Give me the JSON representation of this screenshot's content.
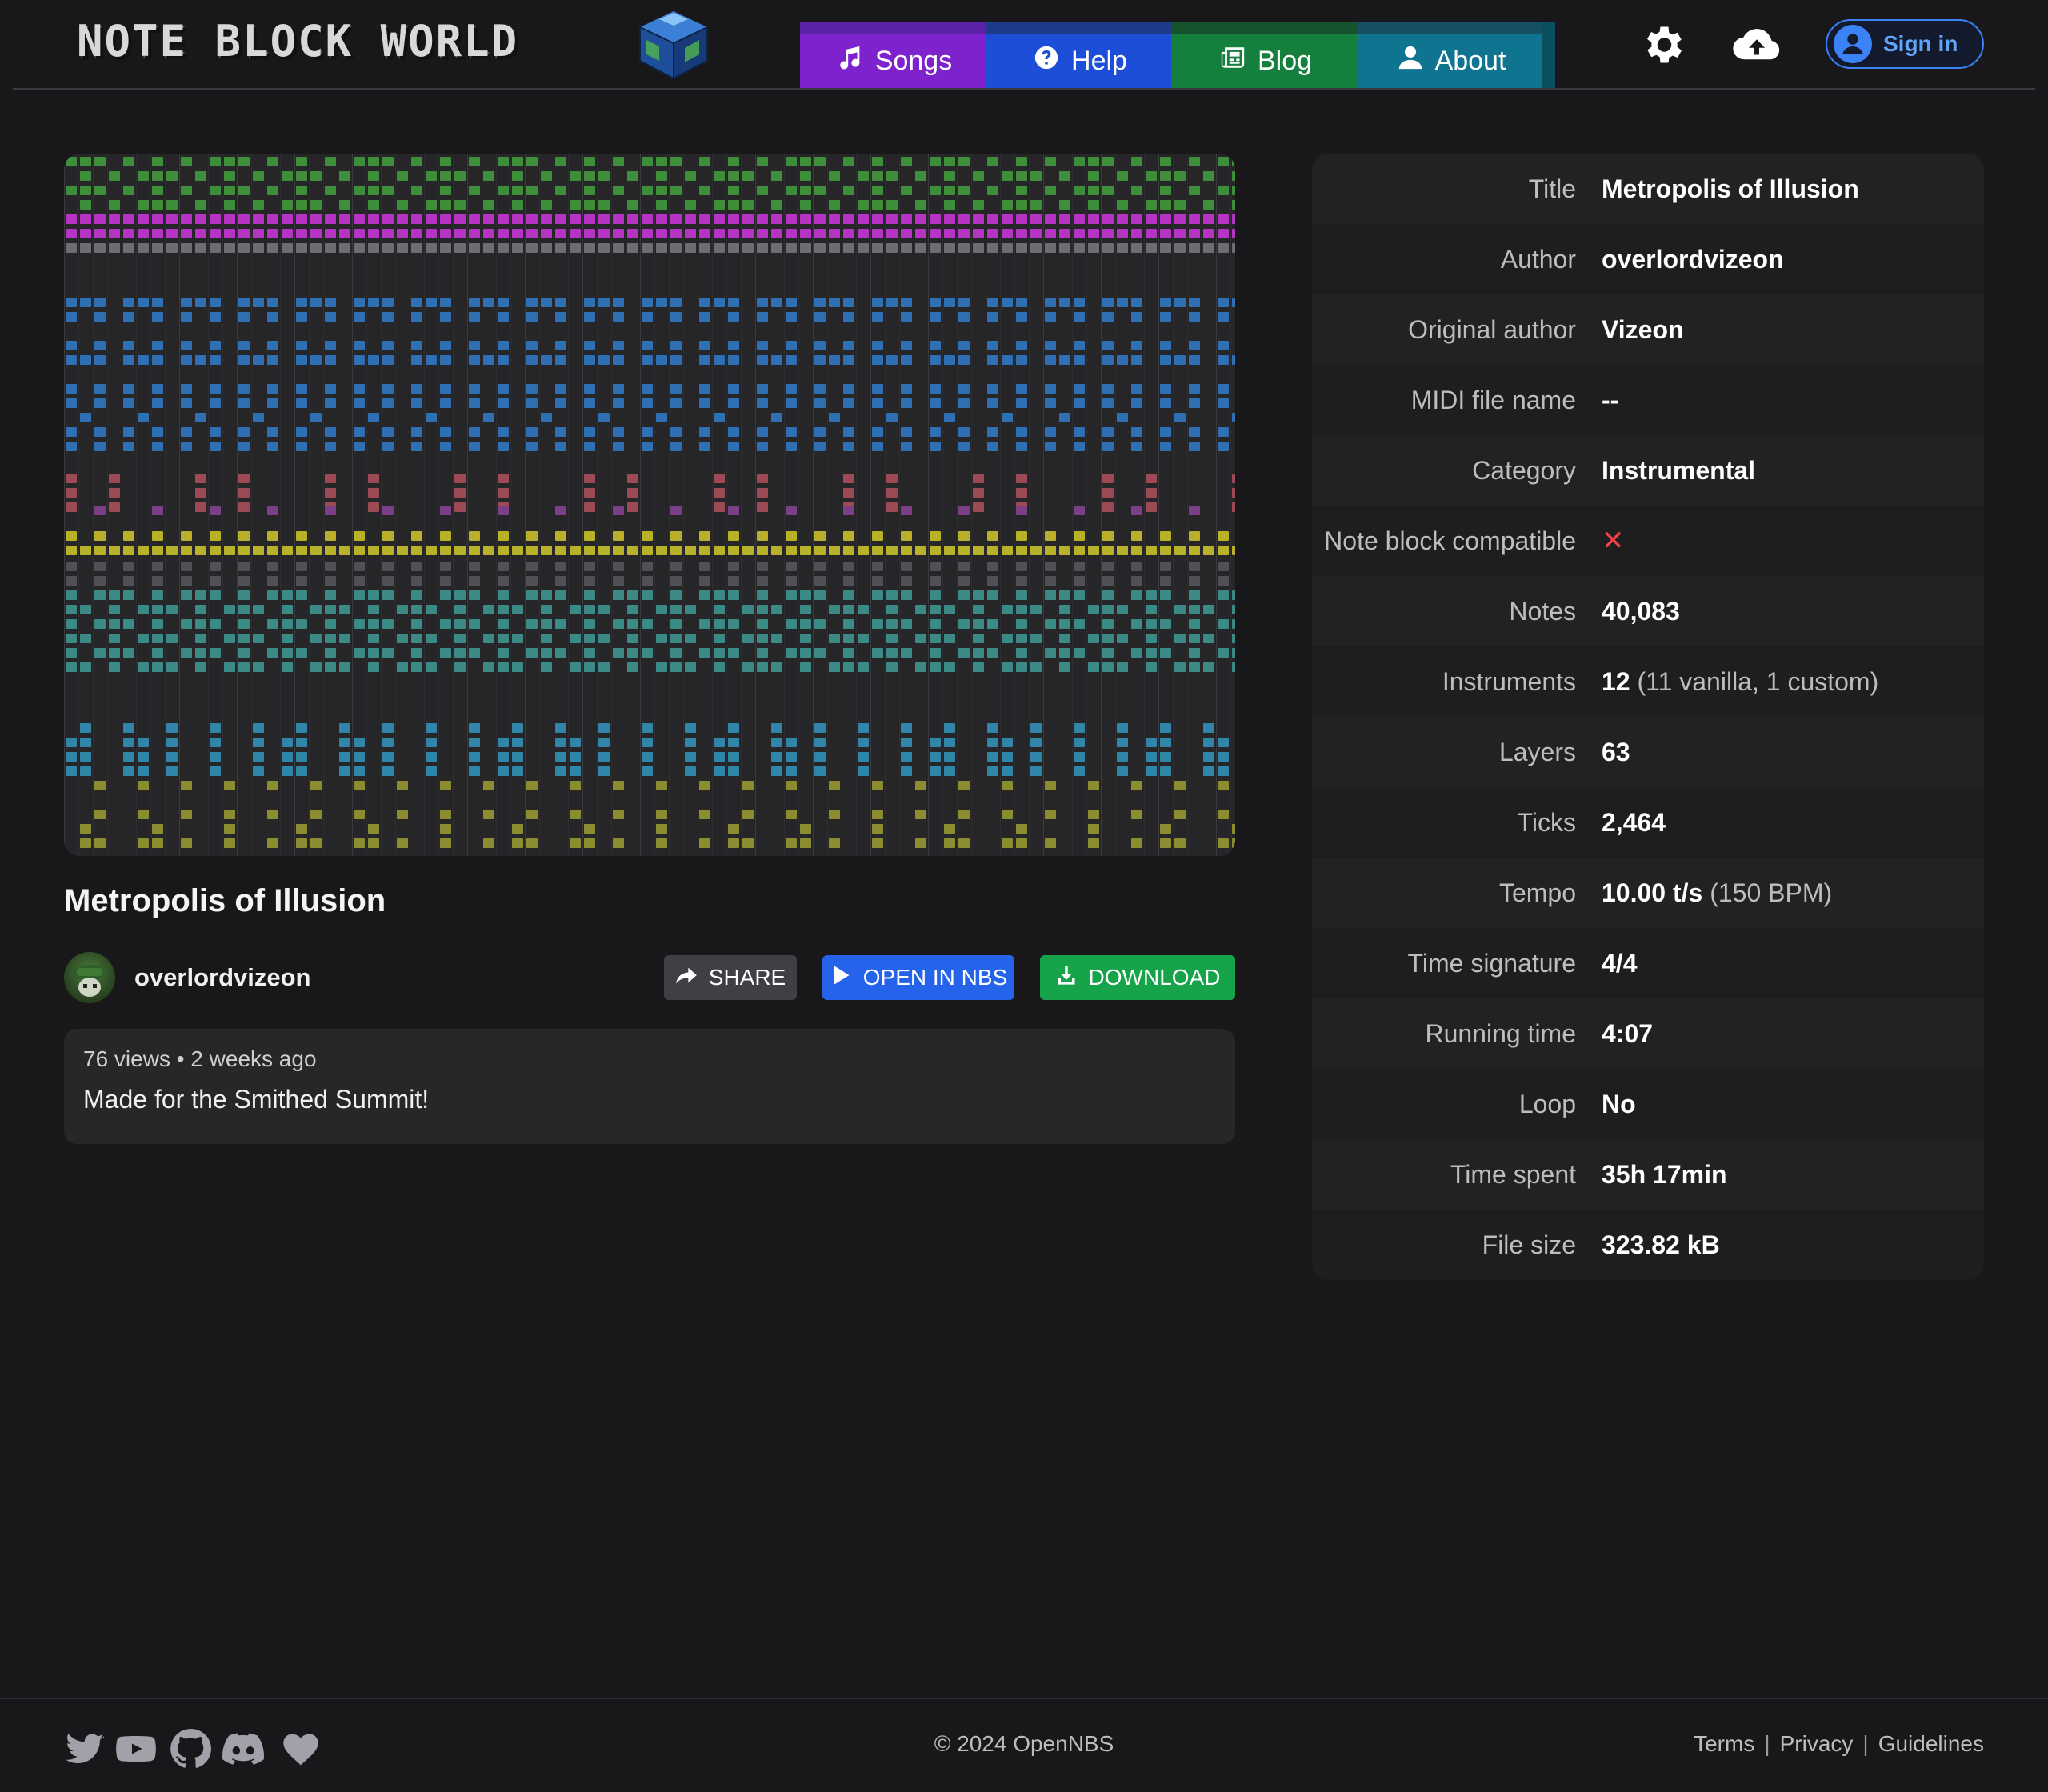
{
  "header": {
    "logo_text": "NOTE BLOCK WORLD",
    "nav": [
      {
        "label": "Songs",
        "icon": "music-note-icon",
        "color": "#7e22ce"
      },
      {
        "label": "Help",
        "icon": "question-circle-icon",
        "color": "#1d4ed8"
      },
      {
        "label": "Blog",
        "icon": "newspaper-icon",
        "color": "#15803d"
      },
      {
        "label": "About",
        "icon": "user-icon",
        "color": "#0e7490"
      }
    ],
    "settings_icon": "gear-icon",
    "upload_icon": "cloud-upload-icon",
    "signin_label": "Sign in"
  },
  "song": {
    "title": "Metropolis of Illusion",
    "uploader": "overlordvizeon",
    "actions": {
      "share": "SHARE",
      "open": "OPEN IN NBS",
      "download": "DOWNLOAD"
    },
    "meta": "76 views • 2 weeks ago",
    "description": "Made for the Smithed Summit!"
  },
  "info": {
    "rows": [
      {
        "label": "Title",
        "value": "Metropolis of Illusion",
        "sub": ""
      },
      {
        "label": "Author",
        "value": "overlordvizeon",
        "sub": ""
      },
      {
        "label": "Original author",
        "value": "Vizeon",
        "sub": ""
      },
      {
        "label": "MIDI file name",
        "value": "--",
        "sub": ""
      },
      {
        "label": "Category",
        "value": "Instrumental",
        "sub": ""
      },
      {
        "label": "Note block compatible",
        "value": "✕",
        "sub": ""
      },
      {
        "label": "Notes",
        "value": "40,083",
        "sub": ""
      },
      {
        "label": "Instruments",
        "value": "12",
        "sub": "(11 vanilla, 1 custom)"
      },
      {
        "label": "Layers",
        "value": "63",
        "sub": ""
      },
      {
        "label": "Ticks",
        "value": "2,464",
        "sub": ""
      },
      {
        "label": "Tempo",
        "value": "10.00 t/s",
        "sub": "(150 BPM)"
      },
      {
        "label": "Time signature",
        "value": "4/4",
        "sub": ""
      },
      {
        "label": "Running time",
        "value": "4:07",
        "sub": ""
      },
      {
        "label": "Loop",
        "value": "No",
        "sub": ""
      },
      {
        "label": "Time spent",
        "value": "35h 17min",
        "sub": ""
      },
      {
        "label": "File size",
        "value": "323.82 kB",
        "sub": ""
      }
    ]
  },
  "footer": {
    "social": [
      "twitter-icon",
      "youtube-icon",
      "github-icon",
      "discord-icon",
      "heart-icon"
    ],
    "copyright": "© 2024 OpenNBS",
    "links": [
      "Terms",
      "Privacy",
      "Guidelines"
    ]
  },
  "colors": {
    "background": "#18181b",
    "accent": "#3b82f6",
    "cross": "#ef4444",
    "download": "#16a34a",
    "open": "#2563eb"
  }
}
